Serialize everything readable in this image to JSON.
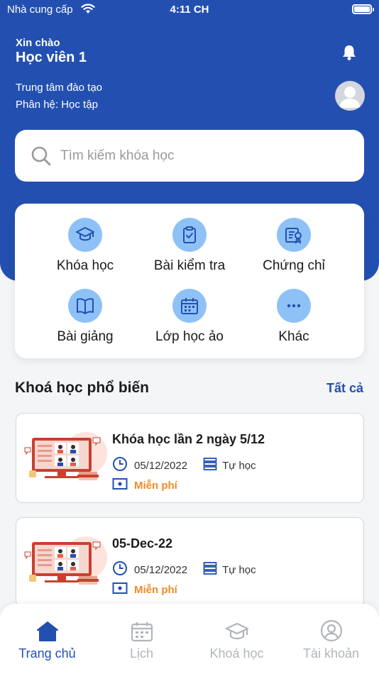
{
  "status_bar": {
    "carrier": "Nhà cung cấp",
    "time": "4:11 CH"
  },
  "header": {
    "greeting": "Xin chào",
    "username": "Học viên 1",
    "center": "Trung tâm đào tạo",
    "module": "Phân hệ: Học tập"
  },
  "search": {
    "placeholder": "Tìm kiếm khóa học"
  },
  "menu": {
    "items": [
      {
        "label": "Khóa học",
        "icon": "graduation-cap-icon"
      },
      {
        "label": "Bài kiểm tra",
        "icon": "clipboard-check-icon"
      },
      {
        "label": "Chứng chỉ",
        "icon": "certificate-icon"
      },
      {
        "label": "Bài giảng",
        "icon": "book-icon"
      },
      {
        "label": "Lớp học ảo",
        "icon": "calendar-icon"
      },
      {
        "label": "Khác",
        "icon": "more-icon"
      }
    ]
  },
  "popular": {
    "title": "Khoá học phổ biến",
    "see_all": "Tất cả",
    "courses": [
      {
        "title": "Khóa học lần 2 ngày 5/12",
        "date": "05/12/2022",
        "type": "Tự học",
        "price": "Miễn phí"
      },
      {
        "title": "05-Dec-22",
        "date": "05/12/2022",
        "type": "Tự học",
        "price": "Miễn phí"
      }
    ]
  },
  "nav": {
    "items": [
      {
        "label": "Trang chủ",
        "icon": "home-icon",
        "active": true
      },
      {
        "label": "Lịch",
        "icon": "calendar-icon",
        "active": false
      },
      {
        "label": "Khoá học",
        "icon": "graduation-cap-icon",
        "active": false
      },
      {
        "label": "Tài khoản",
        "icon": "account-icon",
        "active": false
      }
    ]
  },
  "colors": {
    "primary": "#2350b0",
    "icon_bg": "#8ec2f7",
    "price": "#f08a24",
    "inactive": "#b1b5bc"
  }
}
